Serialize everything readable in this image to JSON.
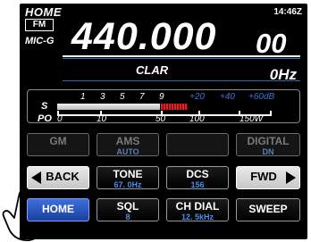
{
  "header": {
    "mode": "HOME",
    "time": "14:46",
    "tz": "Z",
    "band_badge": "FM",
    "mic_gain_label": "MIC-G"
  },
  "frequency": {
    "main": "440.000",
    "sub": "00"
  },
  "clar": {
    "label": "CLAR",
    "value": "0Hz"
  },
  "meter": {
    "s_label": "S",
    "po_label": "PO",
    "s_ticks": [
      "1",
      "3",
      "5",
      "7",
      "9"
    ],
    "s_plus_ticks": [
      "+20",
      "+40",
      "+60dB"
    ],
    "po_ticks": [
      "0",
      "10",
      "50",
      "100",
      "150W"
    ],
    "s_level_fraction": 0.55
  },
  "buttons": {
    "row1": [
      {
        "label": "GM",
        "sub": ""
      },
      {
        "label": "AMS",
        "sub": "AUTO"
      },
      {
        "label": "",
        "sub": ""
      },
      {
        "label": "DIGITAL",
        "sub": "DN"
      }
    ],
    "row2": [
      {
        "label": "BACK",
        "sub": ""
      },
      {
        "label": "TONE",
        "sub": "67. 0Hz"
      },
      {
        "label": "DCS",
        "sub": "156"
      },
      {
        "label": "FWD",
        "sub": ""
      }
    ],
    "row3": [
      {
        "label": "HOME",
        "sub": ""
      },
      {
        "label": "SQL",
        "sub": "8"
      },
      {
        "label": "CH DIAL",
        "sub": "12. 5kHz"
      },
      {
        "label": "SWEEP",
        "sub": ""
      }
    ]
  },
  "colors": {
    "accent_blue": "#4a8df0",
    "home_button": "#2a55c0",
    "meter_red": "#e02020"
  }
}
